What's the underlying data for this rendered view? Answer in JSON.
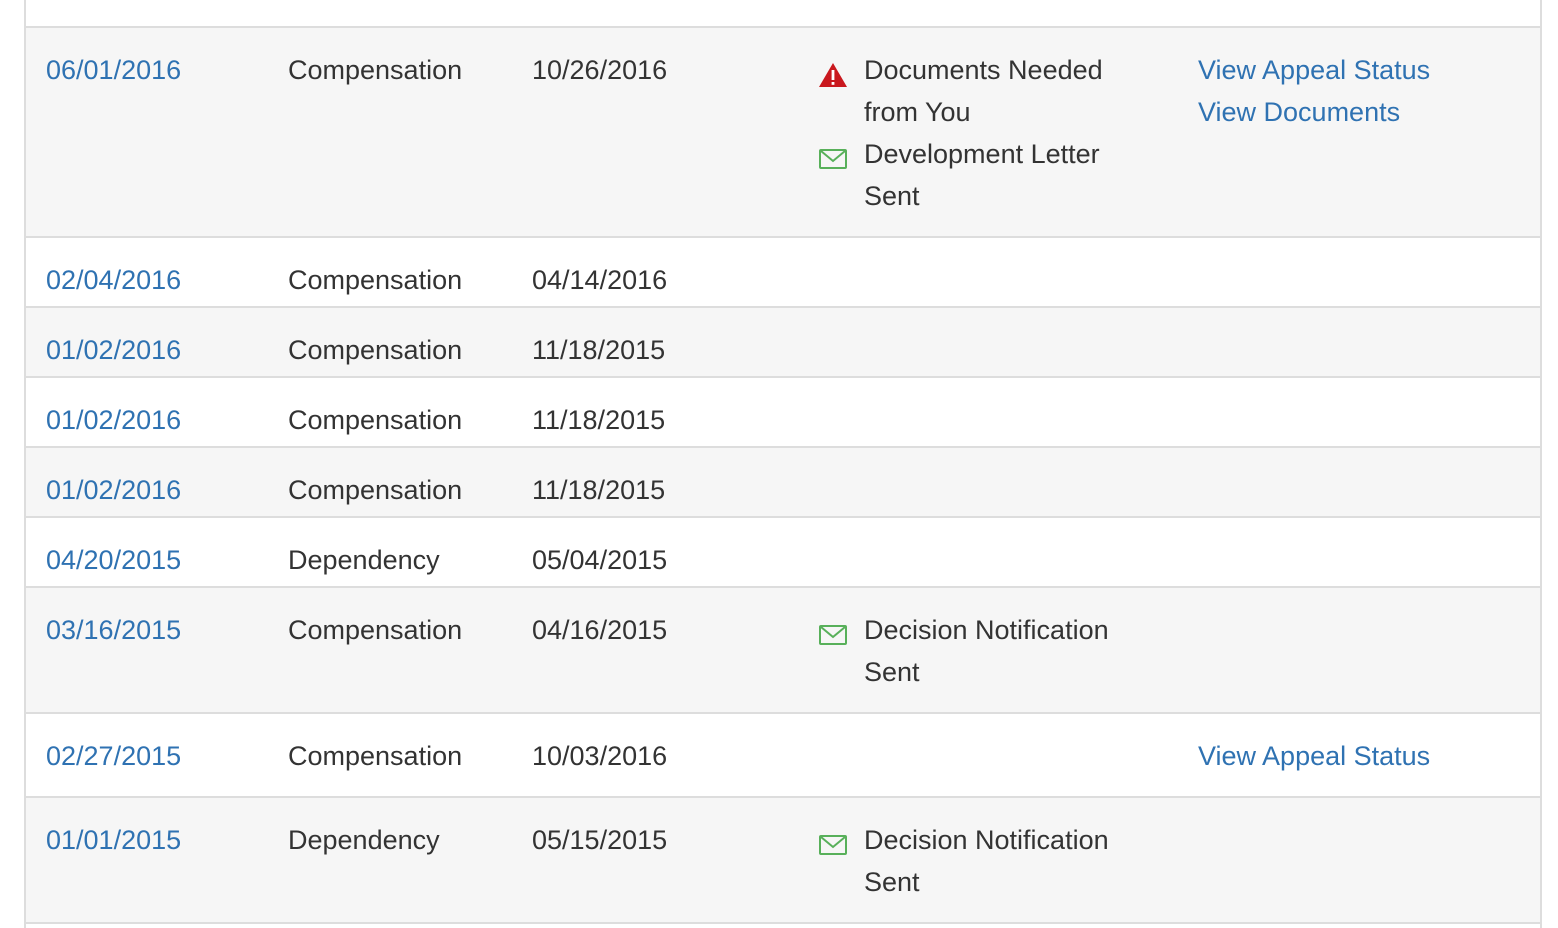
{
  "colors": {
    "link": "#2f72b2",
    "warning": "#c9181e",
    "mail": "#58b05a",
    "row_alt": "#f6f6f6",
    "border": "#dddddd"
  },
  "claims": [
    {
      "date": "06/01/2016",
      "type": "Compensation",
      "updated": "10/26/2016",
      "statuses": [
        {
          "icon": "warning-icon",
          "lines": [
            "Documents Needed",
            "from You"
          ]
        },
        {
          "icon": "mail-icon",
          "lines": [
            "Development Letter",
            "Sent"
          ]
        }
      ],
      "actions": [
        "View Appeal Status",
        "View Documents"
      ]
    },
    {
      "date": "02/04/2016",
      "type": "Compensation",
      "updated": "04/14/2016",
      "statuses": [],
      "actions": []
    },
    {
      "date": "01/02/2016",
      "type": "Compensation",
      "updated": "11/18/2015",
      "statuses": [],
      "actions": []
    },
    {
      "date": "01/02/2016",
      "type": "Compensation",
      "updated": "11/18/2015",
      "statuses": [],
      "actions": []
    },
    {
      "date": "01/02/2016",
      "type": "Compensation",
      "updated": "11/18/2015",
      "statuses": [],
      "actions": []
    },
    {
      "date": "04/20/2015",
      "type": "Dependency",
      "updated": "05/04/2015",
      "statuses": [],
      "actions": []
    },
    {
      "date": "03/16/2015",
      "type": "Compensation",
      "updated": "04/16/2015",
      "statuses": [
        {
          "icon": "mail-icon",
          "lines": [
            "Decision Notification",
            "Sent"
          ]
        }
      ],
      "actions": []
    },
    {
      "date": "02/27/2015",
      "type": "Compensation",
      "updated": "10/03/2016",
      "statuses": [],
      "actions": [
        "View Appeal Status"
      ]
    },
    {
      "date": "01/01/2015",
      "type": "Dependency",
      "updated": "05/15/2015",
      "statuses": [
        {
          "icon": "mail-icon",
          "lines": [
            "Decision Notification",
            "Sent"
          ]
        }
      ],
      "actions": []
    }
  ]
}
